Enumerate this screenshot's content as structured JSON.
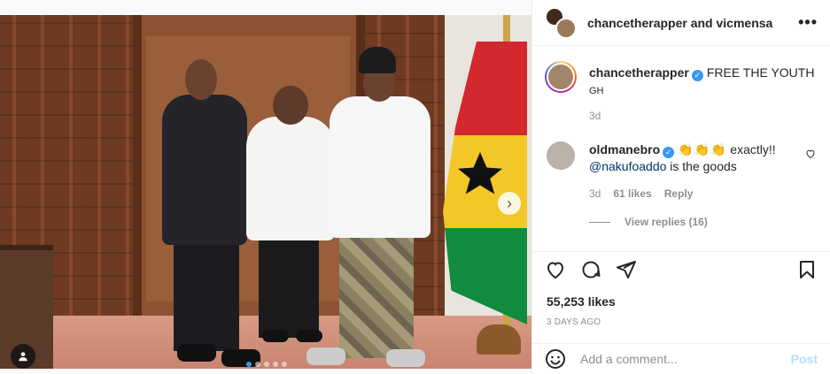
{
  "header": {
    "user1": "chancetherapper",
    "connector": "and",
    "user2": "vicmensa",
    "more_label": "•••"
  },
  "caption": {
    "username": "chancetherapper",
    "text": "FREE THE YOUTH",
    "suffix": "GH",
    "time": "3d"
  },
  "comment": {
    "username": "oldmanebro",
    "claps": "👏👏👏",
    "text_before": " exactly!!",
    "mention": "@nakufoaddo",
    "text_after": " is the goods",
    "time": "3d",
    "likes": "61 likes",
    "reply_label": "Reply",
    "view_replies": "View replies (16)"
  },
  "post": {
    "likes": "55,253 likes",
    "posted": "3 DAYS AGO",
    "carousel_dots": 5,
    "active_dot": 0
  },
  "add_comment": {
    "placeholder": "Add a comment...",
    "post_label": "Post"
  },
  "icons": [
    "heart-icon",
    "comment-icon",
    "share-icon",
    "bookmark-icon",
    "emoji-icon",
    "user-tag-icon",
    "chevron-right-icon",
    "verified-icon",
    "more-icon"
  ],
  "colors": {
    "verified": "#3897f0",
    "post_button": "#b2dffc",
    "mention": "#00376b",
    "muted": "#8e8e8e"
  }
}
